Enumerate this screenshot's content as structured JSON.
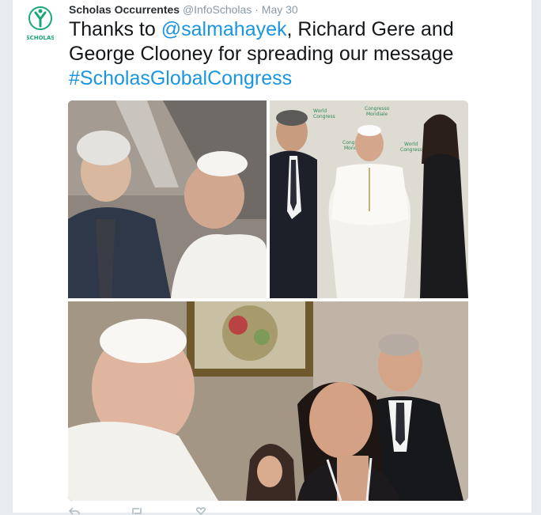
{
  "tweet": {
    "author_name": "Scholas Occurrentes",
    "author_handle": "@InfoScholas",
    "separator": "·",
    "timestamp": "May 30",
    "text_prefix": "Thanks to ",
    "mention": "@salmahayek",
    "text_middle": ", Richard Gere and George Clooney for spreading our message ",
    "hashtag": "#ScholasGlobalCongress",
    "avatar_label": "SCHOLAS"
  },
  "media": {
    "photos": [
      {
        "description_icon": "photo-gere-pope"
      },
      {
        "description_icon": "photo-clooney-pope-amal"
      },
      {
        "description_icon": "photo-hayek-pope"
      }
    ],
    "backdrop_text_1": "World Congress",
    "backdrop_text_2": "Congresso Mondiale"
  },
  "actions": {
    "reply_icon": "reply-icon",
    "retweet_icon": "retweet-icon",
    "like_icon": "like-icon"
  },
  "colors": {
    "brand_green": "#19a77a",
    "link_blue": "#1b95e0",
    "background": "#e6ecf0"
  }
}
